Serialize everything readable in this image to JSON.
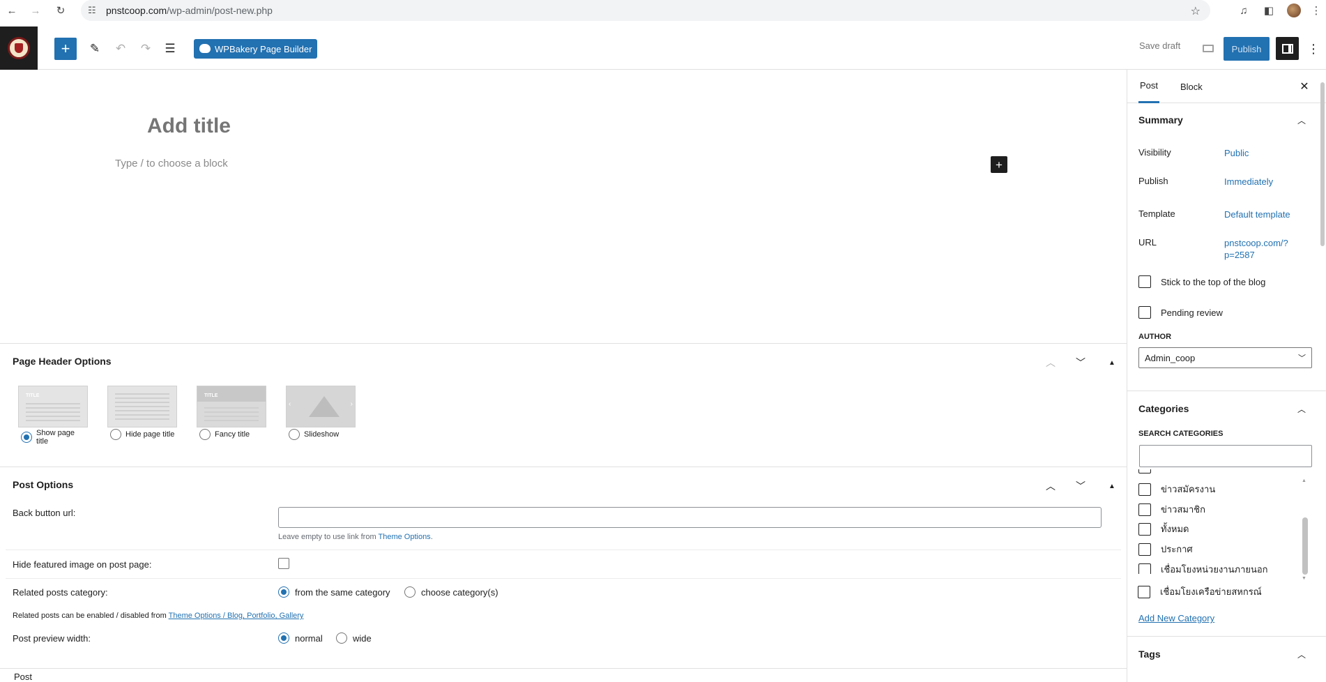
{
  "browser": {
    "url_host": "pnstcoop.com",
    "url_path": "/wp-admin/post-new.php"
  },
  "toolbar": {
    "wpbakery_label": "WPBakery Page Builder",
    "save_draft_label": "Save draft",
    "publish_label": "Publish"
  },
  "editor": {
    "title_placeholder": "Add title",
    "block_placeholder": "Type / to choose a block"
  },
  "page_header_options": {
    "title": "Page Header Options",
    "options": [
      {
        "label": "Show page title",
        "selected": true
      },
      {
        "label": "Hide page title",
        "selected": false
      },
      {
        "label": "Fancy title",
        "selected": false
      },
      {
        "label": "Slideshow",
        "selected": false
      }
    ],
    "thumb_title_text": "TITLE"
  },
  "post_options": {
    "title": "Post Options",
    "back_button_label": "Back button url:",
    "back_button_help_prefix": "Leave empty to use link from ",
    "back_button_help_link": "Theme Options",
    "back_button_help_suffix": ".",
    "hide_featured_label": "Hide featured image on post page:",
    "related_label": "Related posts category:",
    "related_same": "from the same category",
    "related_choose": "choose category(s)",
    "related_note_prefix": "Related posts can be enabled / disabled from ",
    "related_note_link": "Theme Options / Blog, Portfolio, Gallery",
    "preview_width_label": "Post preview width:",
    "preview_normal": "normal",
    "preview_wide": "wide"
  },
  "footer": {
    "breadcrumb": "Post"
  },
  "sidebar": {
    "tab_post": "Post",
    "tab_block": "Block",
    "summary_title": "Summary",
    "visibility_label": "Visibility",
    "visibility_value": "Public",
    "publish_label": "Publish",
    "publish_value": "Immediately",
    "template_label": "Template",
    "template_value": "Default template",
    "url_label": "URL",
    "url_value_line1": "pnstcoop.com/?",
    "url_value_line2": "p=2587",
    "sticky_label": "Stick to the top of the blog",
    "pending_label": "Pending review",
    "author_heading": "AUTHOR",
    "author_value": "Admin_coop",
    "categories_title": "Categories",
    "search_categories_label": "SEARCH CATEGORIES",
    "categories": [
      "ข่าวสมัครงาน",
      "ข่าวสมาชิก",
      "ทั้งหมด",
      "ประกาศ",
      "เชื่อมโยงหน่วยงานภายนอก",
      "เชื่อมโยงเครือข่ายสหกรณ์"
    ],
    "add_category_link": "Add New Category",
    "tags_title": "Tags"
  },
  "colors": {
    "accent": "#2271b1",
    "dark": "#1e1e1e"
  }
}
